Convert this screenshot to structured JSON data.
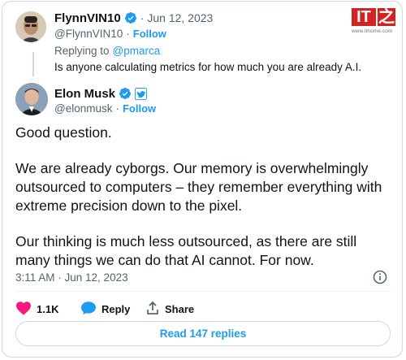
{
  "reply_tweet": {
    "author_name": "FlynnVIN10",
    "handle": "@FlynnVIN10",
    "separator": "·",
    "date": "Jun 12, 2023",
    "follow_label": "Follow",
    "replying_to_prefix": "Replying to",
    "replying_to_handle": "@pmarca",
    "text": "Is anyone calculating metrics for how much you are already A.I."
  },
  "main_tweet": {
    "author_name": "Elon Musk",
    "handle": "@elonmusk",
    "follow_label": "Follow",
    "paragraphs": [
      "Good question.",
      "We are already cyborgs. Our memory is overwhelmingly outsourced to computers – they remember everything with extreme precision down to the pixel.",
      "Our thinking is much less outsourced, as there are still many things we can do that AI cannot. For now."
    ],
    "timestamp": "3:11 AM · Jun 12, 2023",
    "likes": "1.1K",
    "reply_label": "Reply",
    "share_label": "Share",
    "read_replies_label": "Read 147 replies"
  },
  "watermark": {
    "logo_text": "IT",
    "logo_char": "之",
    "url": "www.ithome.com"
  },
  "colors": {
    "accent": "#1d9bf0",
    "like_red": "#f91880",
    "muted": "#536471",
    "border": "#cfd9de",
    "watermark_red": "#d22222"
  },
  "icons": {
    "verified": "verified-badge-icon",
    "affiliate": "twitter-affiliate-icon",
    "info": "info-icon",
    "like": "heart-icon",
    "reply": "speech-bubble-icon",
    "share": "share-icon"
  }
}
